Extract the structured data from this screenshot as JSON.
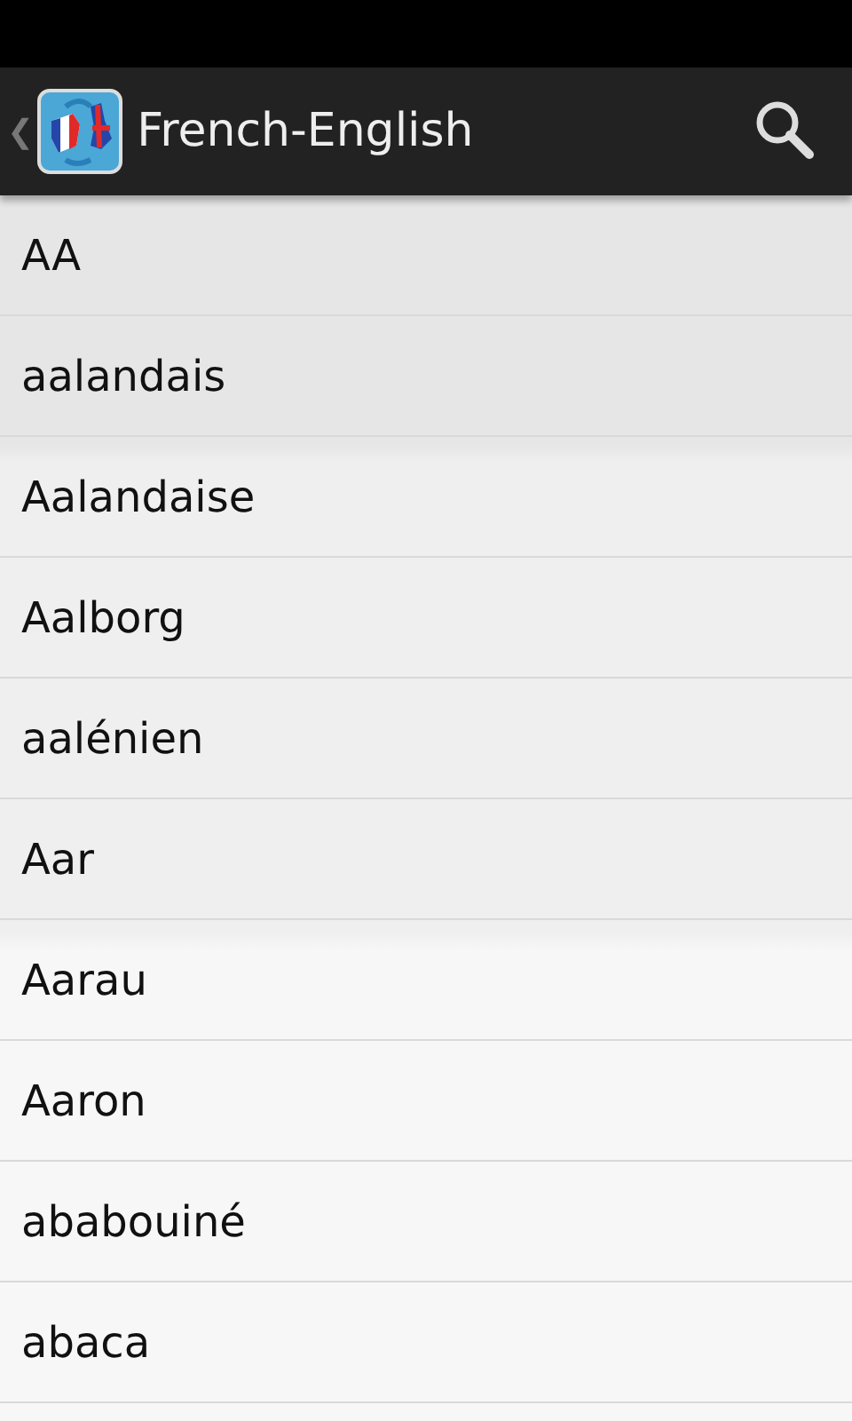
{
  "action_bar": {
    "back": "❮",
    "title": "French-English"
  },
  "words": [
    {
      "text": "AA"
    },
    {
      "text": "aalandais"
    },
    {
      "text": "Aalandaise"
    },
    {
      "text": "Aalborg"
    },
    {
      "text": "aalénien"
    },
    {
      "text": "Aar"
    },
    {
      "text": "Aarau"
    },
    {
      "text": "Aaron"
    },
    {
      "text": "ababouiné"
    },
    {
      "text": "abaca"
    }
  ]
}
